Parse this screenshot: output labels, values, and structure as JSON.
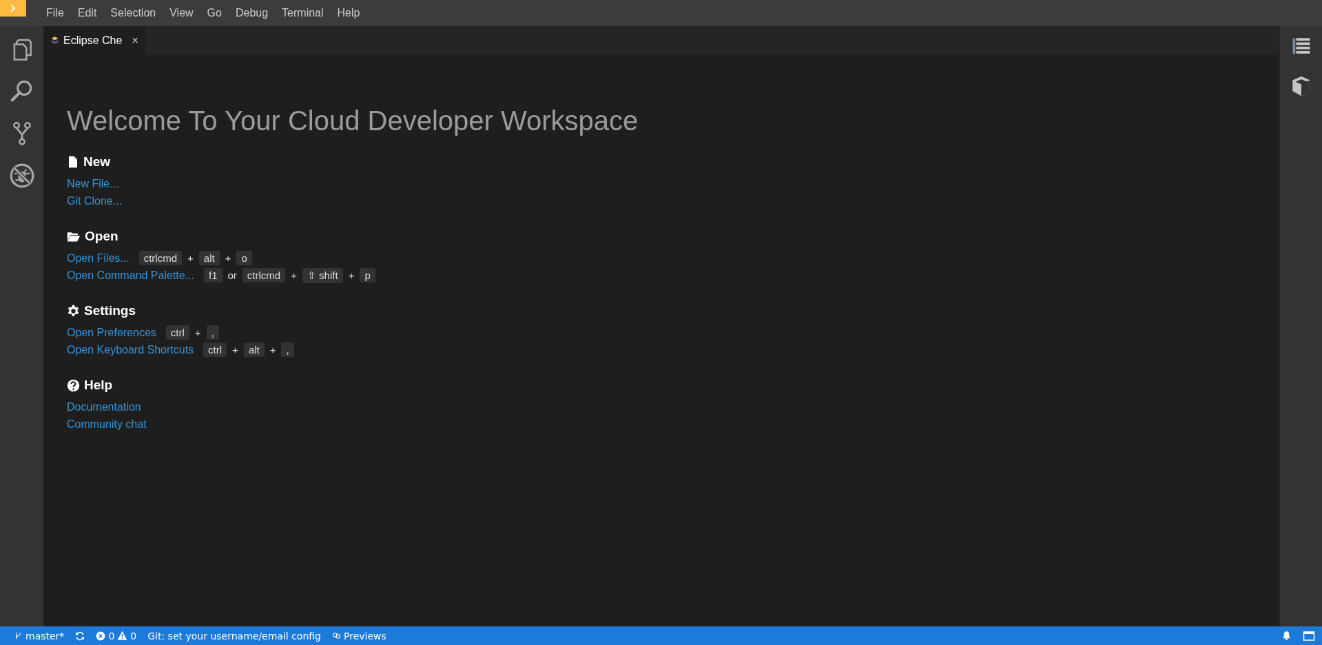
{
  "menu": [
    "File",
    "Edit",
    "Selection",
    "View",
    "Go",
    "Debug",
    "Terminal",
    "Help"
  ],
  "tabs": [
    {
      "label": "Eclipse Che",
      "close": "×",
      "selected": true
    }
  ],
  "welcome": {
    "title": "Welcome To Your Cloud Developer Workspace",
    "sections": [
      {
        "kind": "file",
        "heading": "New",
        "items": [
          {
            "label": "New File..."
          },
          {
            "label": "Git Clone..."
          }
        ]
      },
      {
        "kind": "folder",
        "heading": "Open",
        "items": [
          {
            "label": "Open Files...",
            "shortcut": [
              {
                "kind": "key",
                "text": "ctrlcmd"
              },
              {
                "kind": "text",
                "text": "+"
              },
              {
                "kind": "key",
                "text": "alt"
              },
              {
                "kind": "text",
                "text": "+"
              },
              {
                "kind": "key",
                "text": "o"
              }
            ]
          },
          {
            "label": "Open Command Palette...",
            "shortcut": [
              {
                "kind": "key",
                "text": "f1"
              },
              {
                "kind": "text",
                "text": "or"
              },
              {
                "kind": "key",
                "text": "ctrlcmd"
              },
              {
                "kind": "text",
                "text": "+"
              },
              {
                "kind": "key",
                "text": "⇧ shift"
              },
              {
                "kind": "text",
                "text": "+"
              },
              {
                "kind": "key",
                "text": "p"
              }
            ]
          }
        ]
      },
      {
        "kind": "gear",
        "heading": "Settings",
        "items": [
          {
            "label": "Open Preferences",
            "shortcut": [
              {
                "kind": "key",
                "text": "ctrl"
              },
              {
                "kind": "text",
                "text": "+"
              },
              {
                "kind": "key",
                "text": ","
              }
            ]
          },
          {
            "label": "Open Keyboard Shortcuts",
            "shortcut": [
              {
                "kind": "key",
                "text": "ctrl"
              },
              {
                "kind": "text",
                "text": "+"
              },
              {
                "kind": "key",
                "text": "alt"
              },
              {
                "kind": "text",
                "text": "+"
              },
              {
                "kind": "key",
                "text": ","
              }
            ]
          }
        ]
      },
      {
        "kind": "help",
        "heading": "Help",
        "items": [
          {
            "label": "Documentation"
          },
          {
            "label": "Community chat"
          }
        ]
      }
    ]
  },
  "status_bar": {
    "branch": "master*",
    "errors": "0",
    "warnings": "0",
    "message": "Git: set your username/email config",
    "previews": "Previews"
  }
}
